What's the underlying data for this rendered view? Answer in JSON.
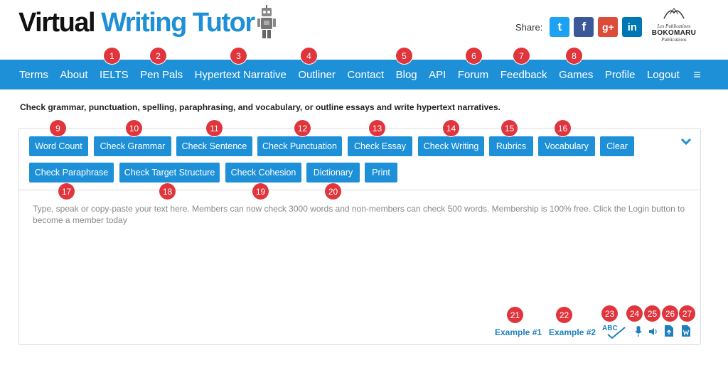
{
  "brand": {
    "word1": "Virtual",
    "word2": "Writing",
    "word3": "Tutor",
    "colors": {
      "dark": "#111111",
      "blue": "#1f8fd6"
    }
  },
  "share": {
    "label": "Share:",
    "networks": [
      "twitter-icon",
      "facebook-icon",
      "google-plus-icon",
      "linkedin-icon"
    ],
    "twitter_glyph": "t",
    "facebook_glyph": "f",
    "googleplus_glyph": "g+",
    "linkedin_glyph": "in"
  },
  "publisher": {
    "line1": "Les Publications",
    "line2": "BOKOMARU",
    "line3": "Publications"
  },
  "nav": {
    "items": [
      "Terms",
      "About",
      "IELTS",
      "Pen Pals",
      "Hypertext Narrative",
      "Outliner",
      "Contact",
      "Blog",
      "API",
      "Forum",
      "Feedback",
      "Games",
      "Profile",
      "Logout"
    ],
    "menu_glyph": "≡",
    "background": "#1e90d8"
  },
  "tagline": "Check grammar, punctuation, spelling, paraphrasing, and vocabulary, or outline essays and write hypertext narratives.",
  "toolbar": {
    "row1": [
      "Word Count",
      "Check Grammar",
      "Check Sentence",
      "Check Punctuation",
      "Check Essay",
      "Check Writing",
      "Rubrics",
      "Vocabulary",
      "Clear"
    ],
    "row2": [
      "Check Paraphrase",
      "Check Target Structure",
      "Check Cohesion",
      "Dictionary",
      "Print"
    ],
    "collapse_icon": "chevron-down-icon"
  },
  "editor": {
    "placeholder": "Type, speak or copy-paste your text here. Members can now check 3000 words and non-members can check 500 words. Membership is 100% free. Click the Login button to become a member today"
  },
  "examples": [
    "Example #1",
    "Example #2"
  ],
  "tools": {
    "spellcheck_text": "ABC",
    "icons": [
      "spellcheck-icon",
      "microphone-icon",
      "speaker-icon",
      "upload-file-icon",
      "word-document-icon"
    ]
  },
  "badges": [
    "1",
    "2",
    "3",
    "4",
    "5",
    "6",
    "7",
    "8",
    "9",
    "10",
    "11",
    "12",
    "13",
    "14",
    "15",
    "16",
    "17",
    "18",
    "19",
    "20",
    "21",
    "22",
    "23",
    "24",
    "25",
    "26",
    "27"
  ],
  "badge_color": "#e0353c"
}
